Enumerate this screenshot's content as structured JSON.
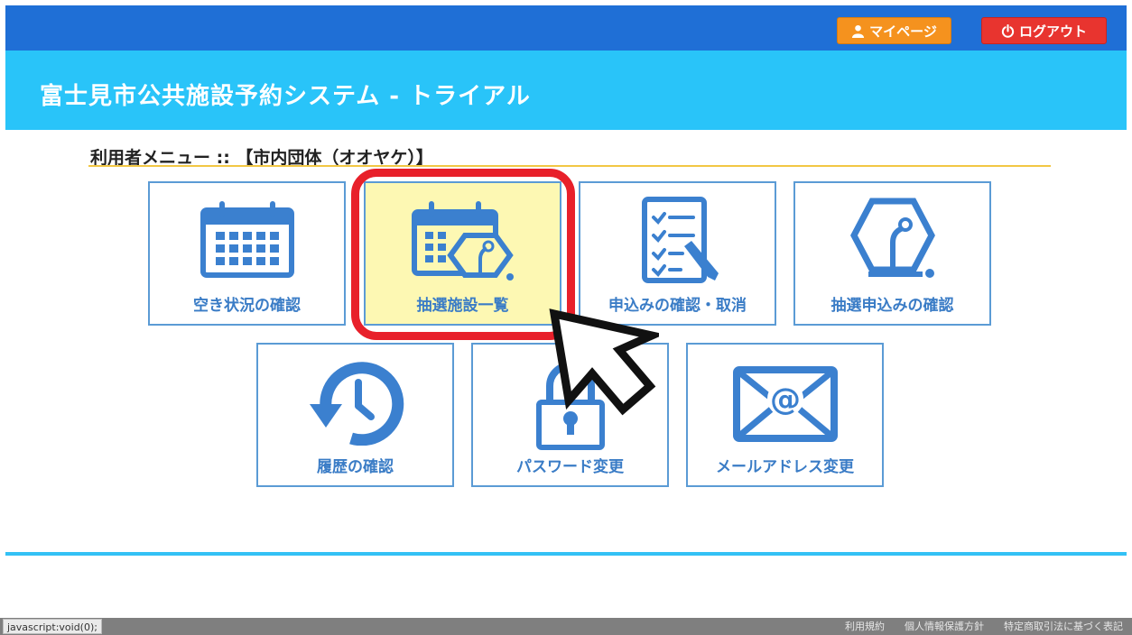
{
  "header": {
    "mypage_label": "マイページ",
    "logout_label": "ログアウト",
    "title": "富士見市公共施設予約システム - トライアル"
  },
  "menu": {
    "heading": "利用者メニュー :: 【市内団体（オオヤケ）】",
    "tiles": [
      {
        "label": "空き状況の確認",
        "icon": "calendar-icon"
      },
      {
        "label": "抽選施設一覧",
        "icon": "lottery-facility-icon"
      },
      {
        "label": "申込みの確認・取消",
        "icon": "checklist-icon"
      },
      {
        "label": "抽選申込みの確認",
        "icon": "lottery-icon"
      },
      {
        "label": "履歴の確認",
        "icon": "history-clock-icon"
      },
      {
        "label": "パスワード変更",
        "icon": "lock-icon"
      },
      {
        "label": "メールアドレス変更",
        "icon": "mail-icon"
      }
    ]
  },
  "status_bar": {
    "url": "javascript:void(0);"
  },
  "footer": {
    "links": [
      "利用規約",
      "個人情報保護方針",
      "特定商取引法に基づく表記"
    ]
  },
  "colors": {
    "topbar": "#1f6fd6",
    "hero": "#29c4f9",
    "tile_border": "#5b9bd5",
    "tile_text": "#3a7cc6",
    "highlight": "#fdf8b3",
    "mypage_button": "#f5921e",
    "logout_button": "#e8342f",
    "focus_ring": "#e8202a"
  }
}
